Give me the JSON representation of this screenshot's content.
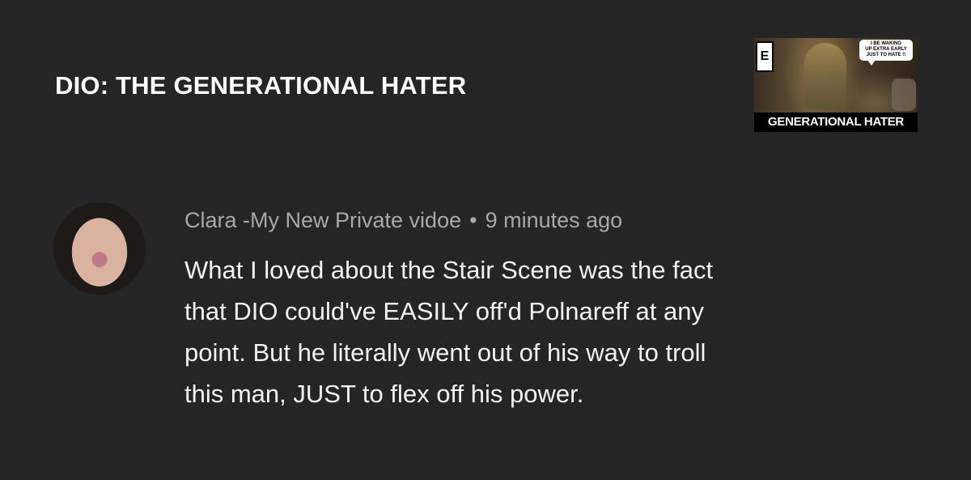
{
  "video": {
    "title": "DIO: THE GENERATIONAL HATER",
    "thumbnail": {
      "caption": "GENERATIONAL HATER",
      "rating_badge": "E",
      "speech_bubble_lines": [
        "I BE WAKING",
        "UP EXTRA EARLY",
        "JUST TO HATE !!"
      ]
    }
  },
  "comment": {
    "author": "Clara -My New Private vidoe",
    "separator": "•",
    "timestamp": "9 minutes ago",
    "lines": [
      "What I loved about the Stair Scene was the fact",
      "that DIO could've EASILY off'd Polnareff at any",
      "point. But he literally went out of his way to troll",
      "this man, JUST to flex off his power."
    ]
  },
  "colors": {
    "background": "#252525",
    "title_text": "#ffffff",
    "meta_text": "#a8a8a8",
    "body_text": "#f2f2f2"
  }
}
